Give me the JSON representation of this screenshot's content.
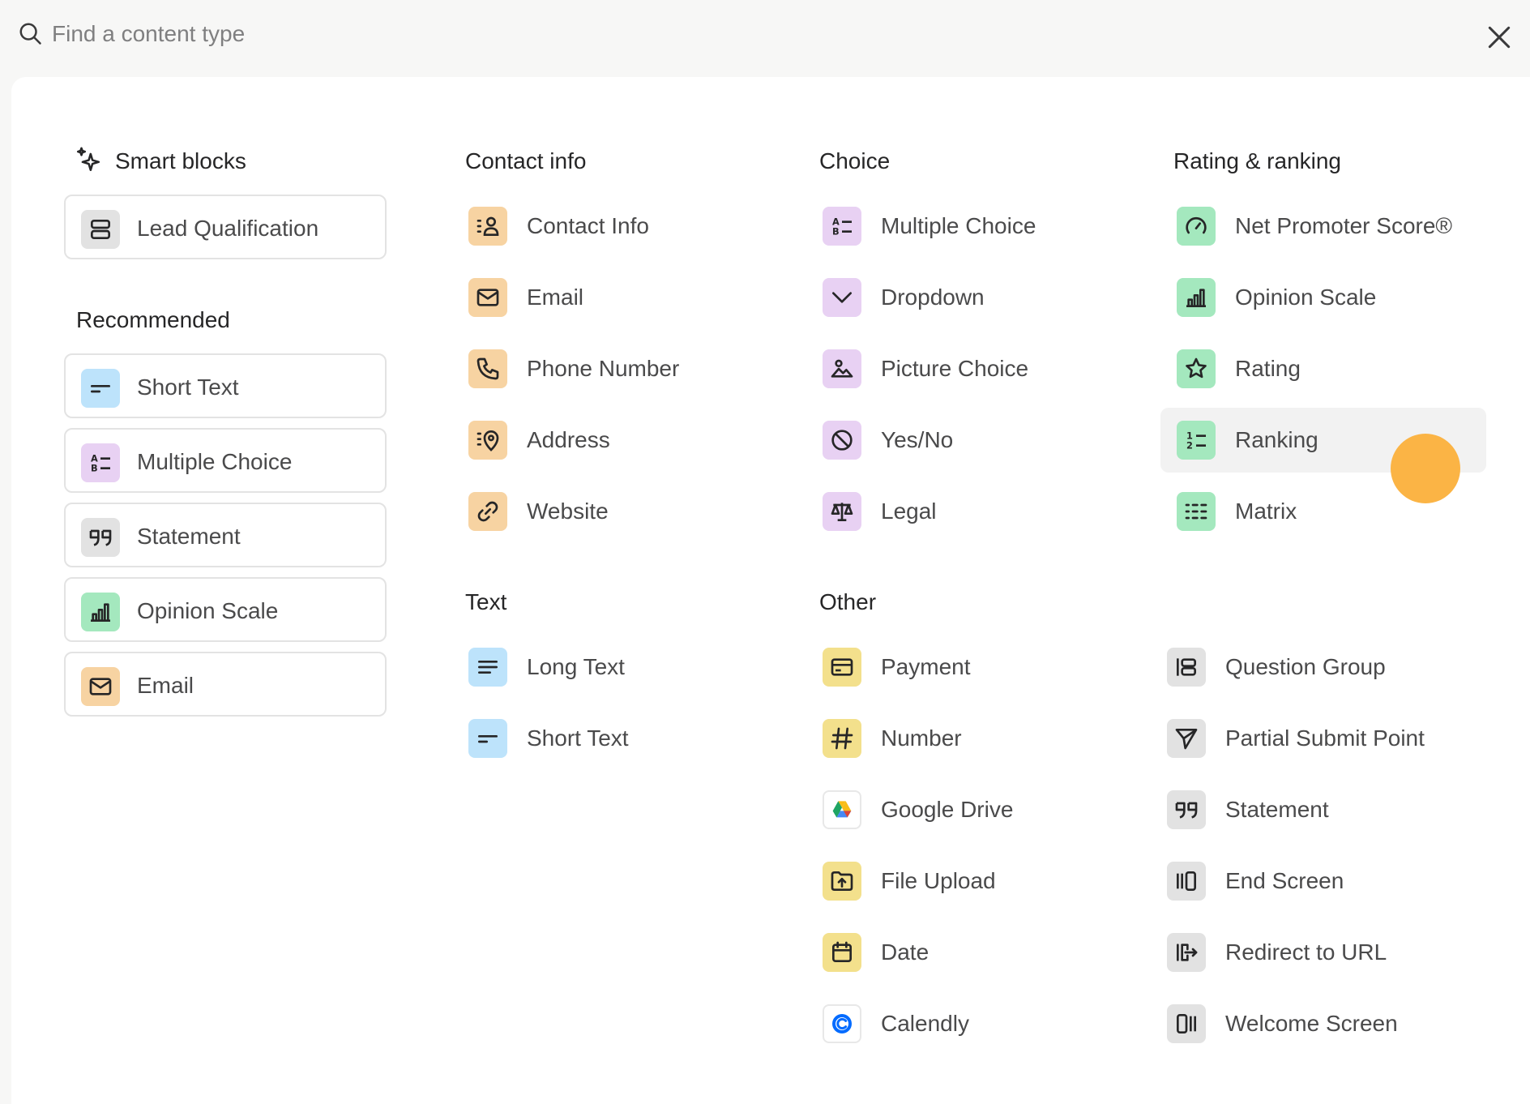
{
  "search": {
    "placeholder": "Find a content type"
  },
  "sections": {
    "smart_blocks": "Smart blocks",
    "recommended": "Recommended",
    "contact_info": "Contact info",
    "text": "Text",
    "choice": "Choice",
    "other": "Other",
    "rating_ranking": "Rating & ranking"
  },
  "smart_blocks": {
    "lead_qualification": "Lead Qualification"
  },
  "recommended": {
    "short_text": "Short Text",
    "multiple_choice": "Multiple Choice",
    "statement": "Statement",
    "opinion_scale": "Opinion Scale",
    "email": "Email"
  },
  "contact_info": {
    "contact_info": "Contact Info",
    "email": "Email",
    "phone_number": "Phone Number",
    "address": "Address",
    "website": "Website"
  },
  "text": {
    "long_text": "Long Text",
    "short_text": "Short Text"
  },
  "choice": {
    "multiple_choice": "Multiple Choice",
    "dropdown": "Dropdown",
    "picture_choice": "Picture Choice",
    "yes_no": "Yes/No",
    "legal": "Legal"
  },
  "other": {
    "payment": "Payment",
    "number": "Number",
    "google_drive": "Google Drive",
    "file_upload": "File Upload",
    "date": "Date",
    "calendly": "Calendly",
    "question_group": "Question Group",
    "partial_submit_point": "Partial Submit Point",
    "statement": "Statement",
    "end_screen": "End Screen",
    "redirect_to_url": "Redirect to URL",
    "welcome_screen": "Welcome Screen"
  },
  "rating_ranking": {
    "net_promoter_score": "Net Promoter Score®",
    "opinion_scale": "Opinion Scale",
    "rating": "Rating",
    "ranking": "Ranking",
    "matrix": "Matrix"
  },
  "colors": {
    "contact": "#f7d3a2",
    "choice": "#e8d1f3",
    "rating": "#a4e8be",
    "text": "#bde3fb",
    "other": "#f3e08c",
    "neutral": "#e2e2e2",
    "hover": "#f2f2f2",
    "cursor": "#fbb03b"
  }
}
